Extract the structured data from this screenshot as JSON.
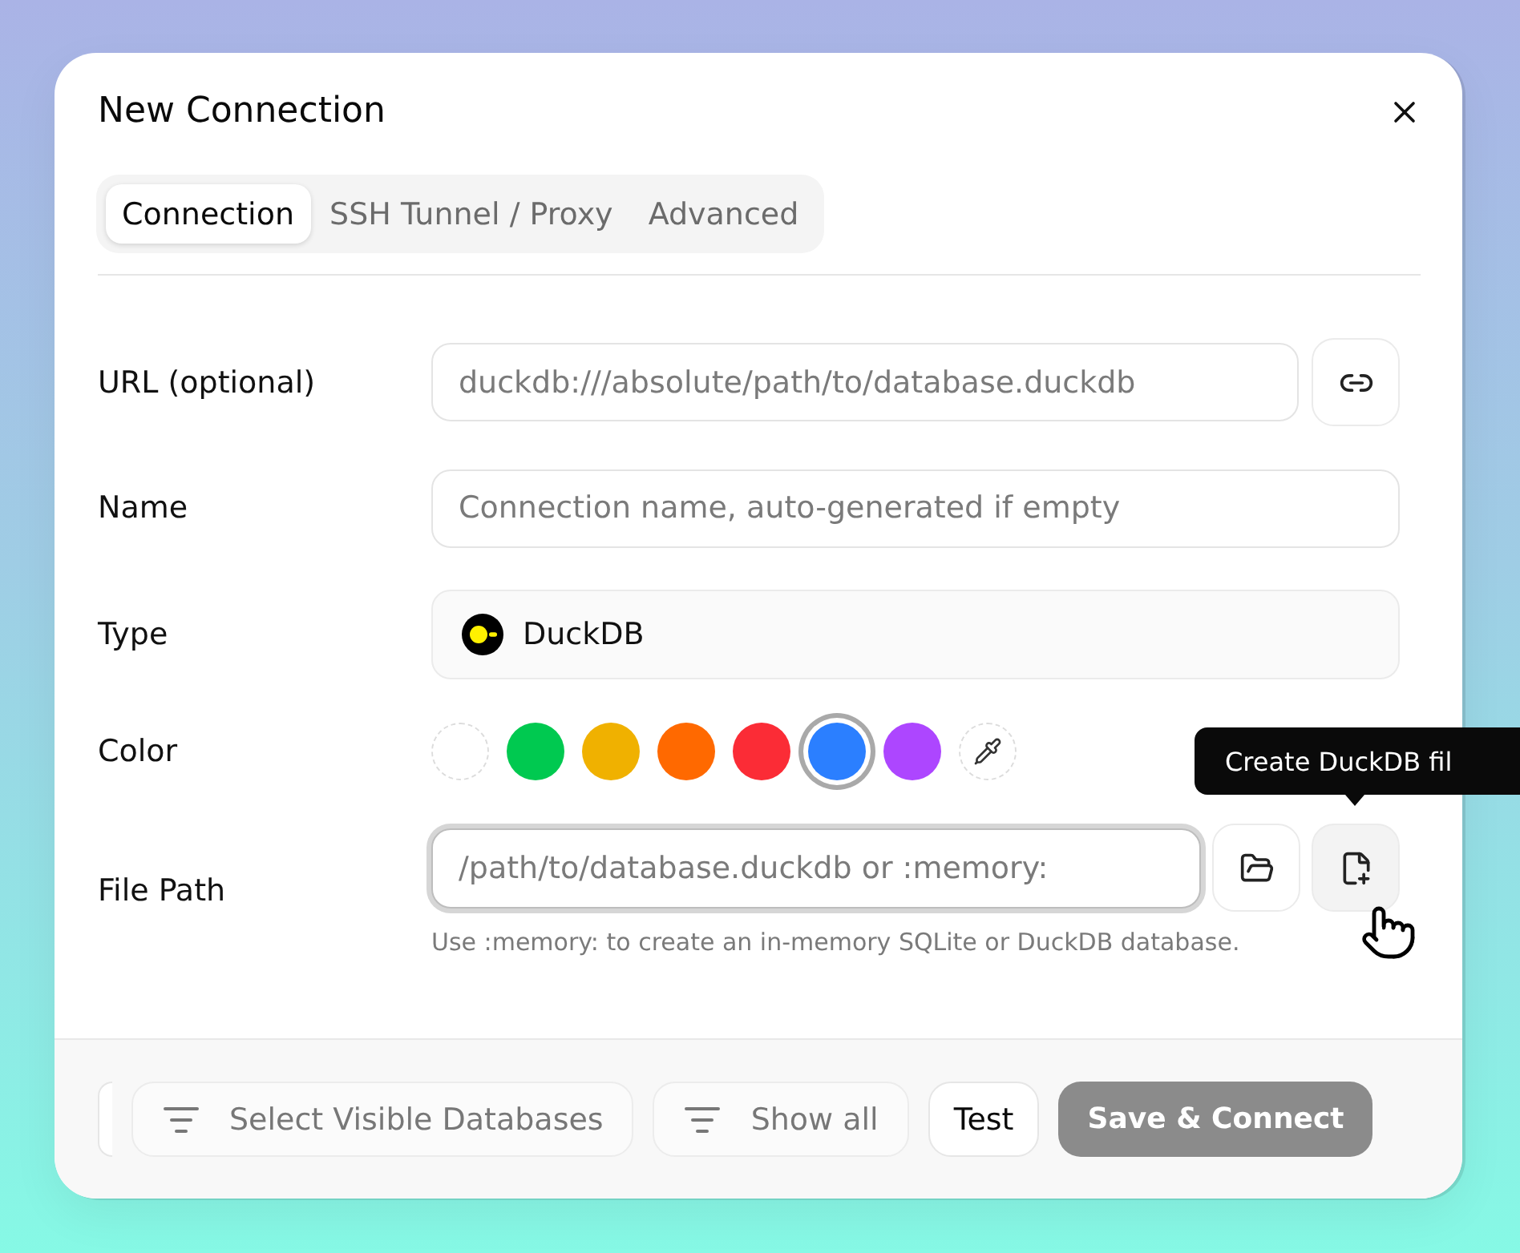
{
  "dialog": {
    "title": "New Connection"
  },
  "tabs": [
    {
      "label": "Connection",
      "selected": true
    },
    {
      "label": "SSH Tunnel / Proxy",
      "selected": false
    },
    {
      "label": "Advanced",
      "selected": false
    }
  ],
  "form": {
    "rows": [
      {
        "kind": "url",
        "label": "URL (optional)",
        "placeholder": "duckdb:///absolute/path/to/database.duckdb"
      },
      {
        "kind": "text",
        "label": "Name",
        "placeholder": "Connection name, auto-generated if empty"
      },
      {
        "kind": "select",
        "label": "Type",
        "value": "DuckDB"
      },
      {
        "kind": "colors",
        "label": "Color",
        "swatches": [
          {
            "kind": "none",
            "selected": false
          },
          {
            "kind": "color",
            "color": "#00c950",
            "selected": false
          },
          {
            "kind": "color",
            "color": "#f0b100",
            "selected": false
          },
          {
            "kind": "color",
            "color": "#ff6900",
            "selected": false
          },
          {
            "kind": "color",
            "color": "#fb2c36",
            "selected": false
          },
          {
            "kind": "color",
            "color": "#2b7fff",
            "selected": true
          },
          {
            "kind": "color",
            "color": "#ad46ff",
            "selected": false
          },
          {
            "kind": "picker",
            "selected": false
          }
        ]
      },
      {
        "kind": "file",
        "label": "File Path",
        "placeholder": "/path/to/database.duckdb or :memory:",
        "focused": true,
        "hint": "Use :memory: to create an in-memory SQLite or DuckDB database.",
        "actions": [
          {
            "kind": "open",
            "hovered": false
          },
          {
            "kind": "new",
            "hovered": true,
            "tooltip": "Create DuckDB fil"
          }
        ]
      }
    ]
  },
  "footer": {
    "buttons": [
      {
        "kind": "clipped"
      },
      {
        "kind": "filter",
        "label": "Select Visible Databases"
      },
      {
        "kind": "filter",
        "label": "Show all"
      },
      {
        "kind": "plain",
        "label": "Test"
      },
      {
        "kind": "primary",
        "label": "Save & Connect",
        "disabled": true
      }
    ]
  }
}
